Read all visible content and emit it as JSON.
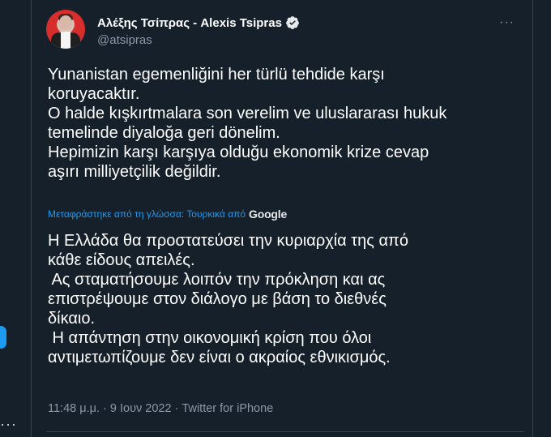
{
  "tweet": {
    "author": {
      "display_name": "Αλέξης Τσίπρας - Alexis Tsipras",
      "handle": "@atsipras",
      "verified": true
    },
    "original_text": [
      "Yunanistan egemenliğini her türlü tehdide karşı",
      "koruyacaktır.",
      "O halde kışkırtmalara son verelim ve uluslararası hukuk",
      "temelinde diyaloğa geri dönelim.",
      "Hepimizin karşı karşıya olduğu ekonomik krize cevap",
      "aşırı milliyetçilik değildir."
    ],
    "translation_note": "Μεταφράστηκε από τη γλώσσα: Τουρκικά από",
    "translation_provider": "Google",
    "translated_text": [
      "Η Ελλάδα θα προστατεύσει την κυριαρχία της από",
      "κάθε είδους απειλές.",
      " Ας σταματήσουμε λοιπόν την πρόκληση και ας",
      "επιστρέψουμε στον διάλογο με βάση το διεθνές",
      "δίκαιο.",
      " Η απάντηση στην οικονομική κρίση που όλοι",
      "αντιμετωπίζουμε δεν είναι ο ακραίος εθνικισμός."
    ],
    "meta": "11:48 μ.μ. · 9 Ιουν 2022 · Twitter for iPhone"
  },
  "icons": {
    "verified": "verified-badge-icon",
    "more": "more-options-icon"
  },
  "colors": {
    "background": "#15202b",
    "accent": "#1d9bf0",
    "muted": "#8b98a5",
    "text": "#ffffff"
  }
}
